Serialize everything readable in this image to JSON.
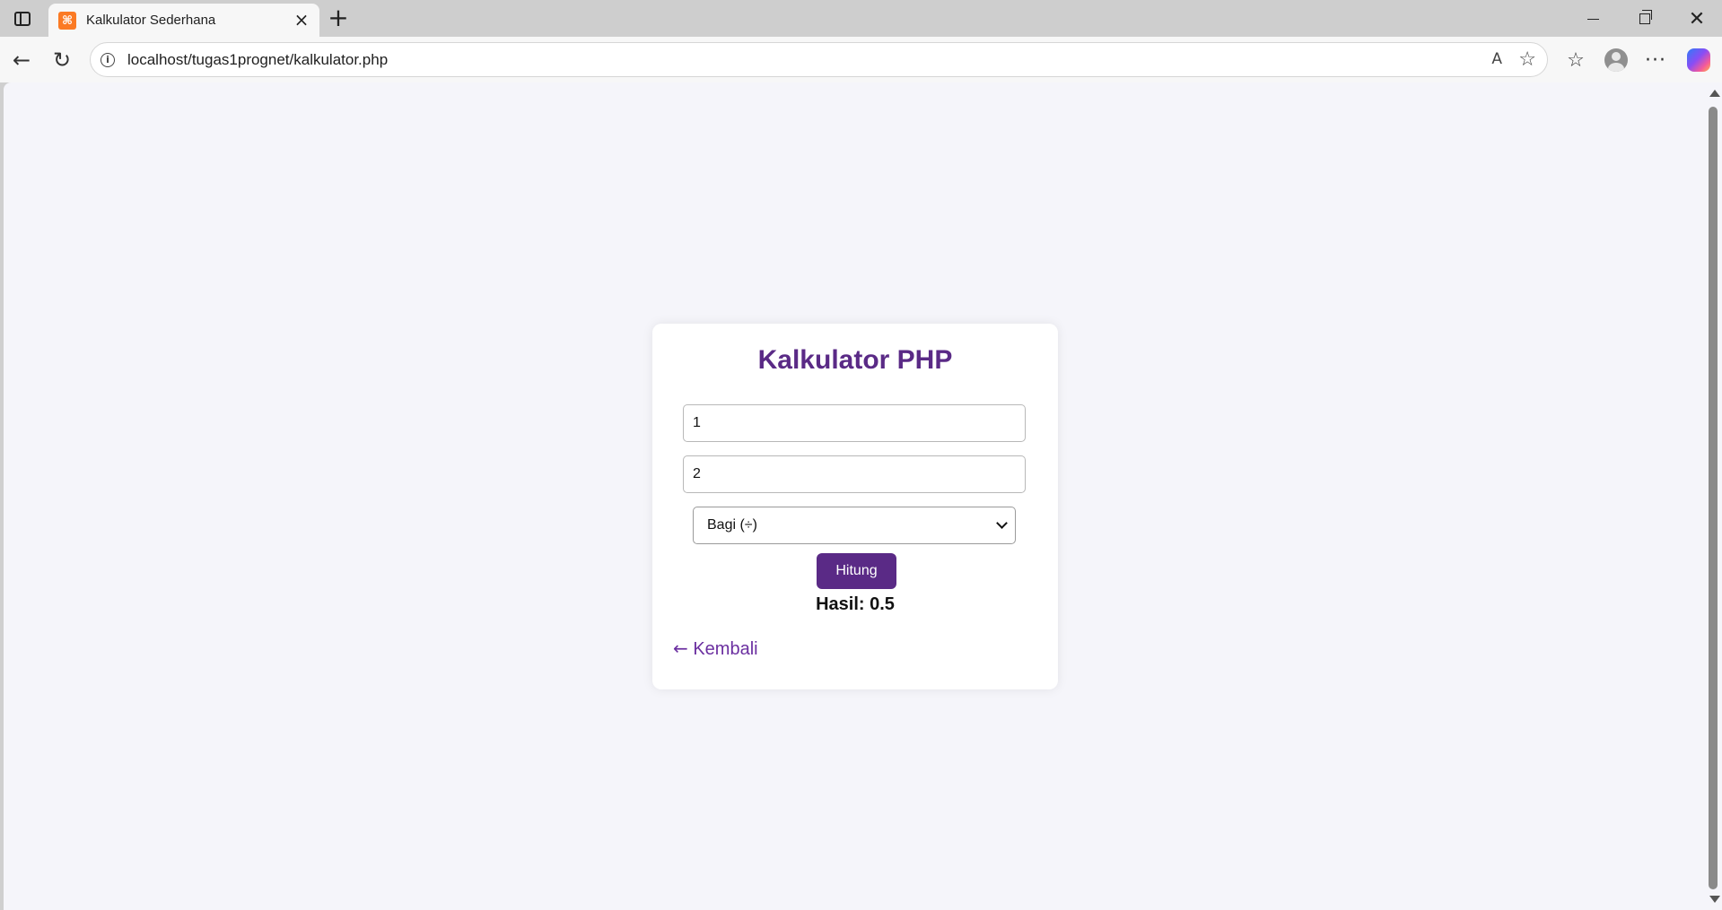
{
  "browser": {
    "tab_title": "Kalkulator Sederhana",
    "tab_favicon_glyph": "⌘",
    "tab_close_glyph": "×",
    "new_tab_glyph": "+",
    "url": "localhost/tugas1prognet/kalkulator.php",
    "icons": {
      "sidebar_toggle": "sidebar-icon",
      "back": "back-arrow-icon",
      "reload": "reload-icon",
      "site_info": "info-icon",
      "read_aloud": "read-aloud-icon",
      "add_favorite": "star-icon",
      "favorites": "favorites-icon",
      "profile": "profile-icon",
      "more": "more-icon",
      "copilot": "copilot-icon",
      "minimize": "minimize-icon",
      "restore": "restore-icon",
      "close": "close-icon"
    },
    "glyphs": {
      "back": "←",
      "reload": "↻",
      "info": "i",
      "read_aloud": "A",
      "star": "☆",
      "favorites": "☆",
      "more": "···",
      "close": "✕"
    }
  },
  "page": {
    "title": "Kalkulator PHP",
    "input1_value": "1",
    "input2_value": "2",
    "operation_selected": "Bagi (÷)",
    "submit_label": "Hitung",
    "result_text": "Hasil: 0.5",
    "back_link_arrow": "←",
    "back_link_label": "Kembali"
  },
  "colors": {
    "accent": "#5a2a86",
    "link": "#6b2fa0",
    "page_background": "#f5f5fa",
    "card_background": "#ffffff"
  }
}
